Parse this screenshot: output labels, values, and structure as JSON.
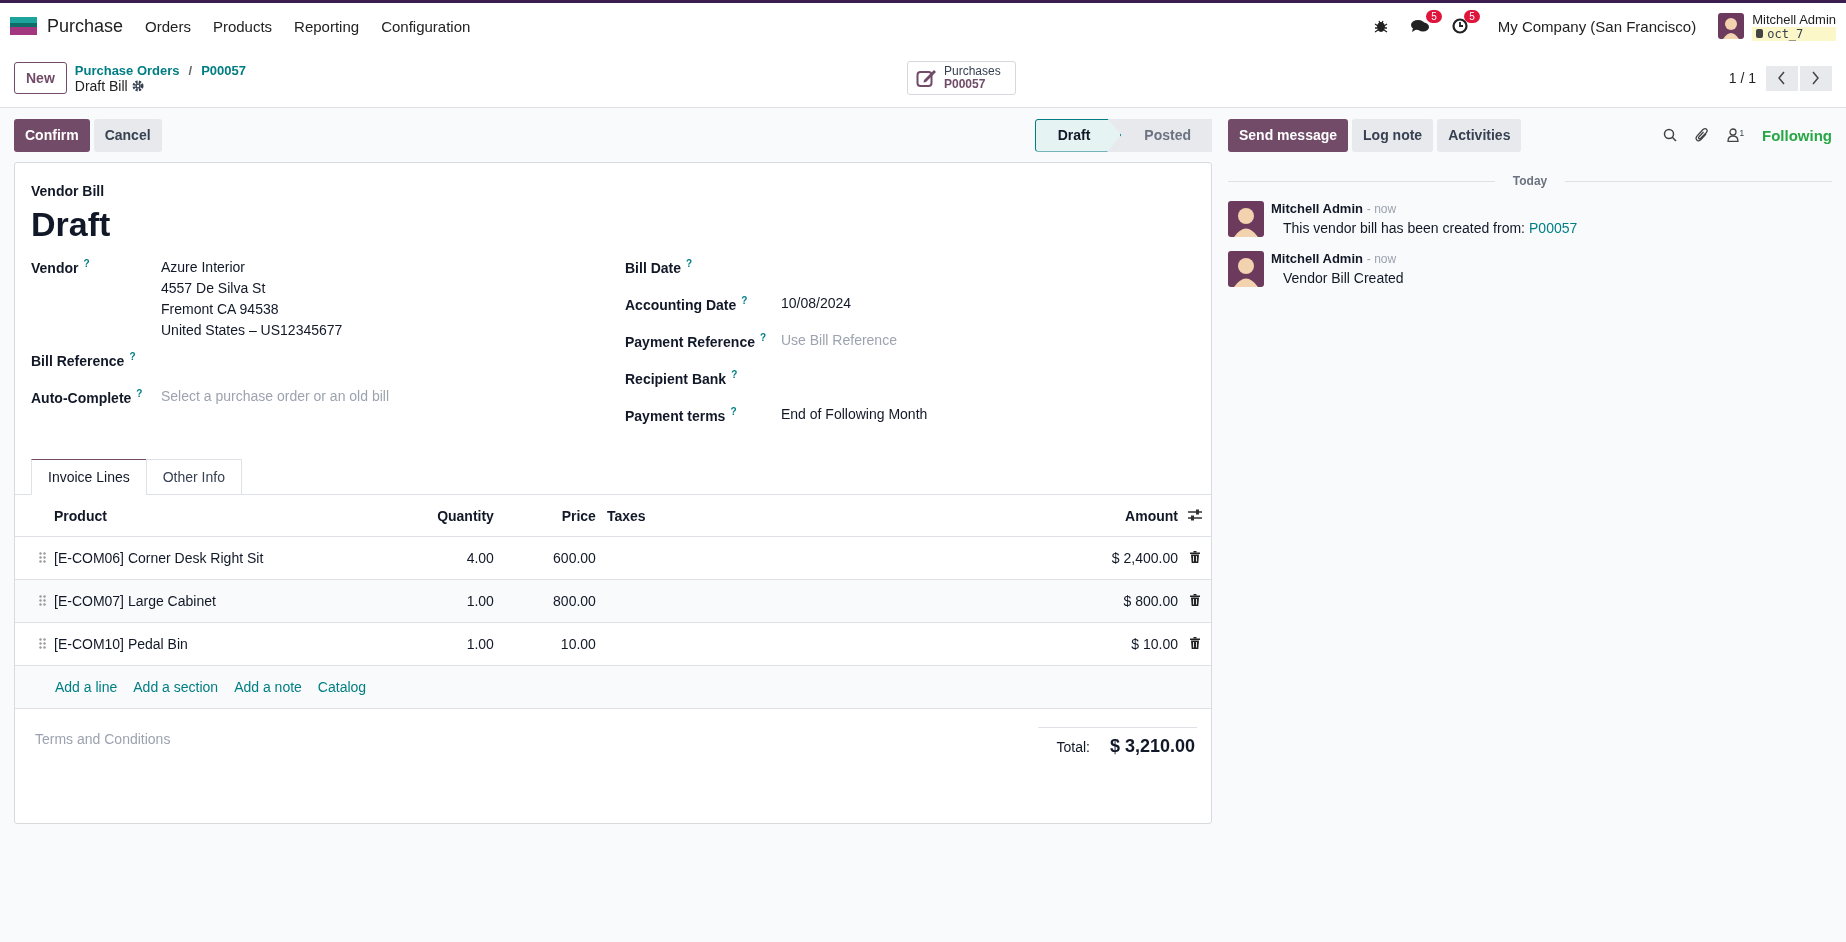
{
  "navbar": {
    "app_name": "Purchase",
    "menu": [
      "Orders",
      "Products",
      "Reporting",
      "Configuration"
    ],
    "messages_count": "5",
    "activities_count": "5",
    "company": "My Company (San Francisco)",
    "user": {
      "name": "Mitchell Admin",
      "database": "oct_7"
    }
  },
  "control_panel": {
    "new_button": "New",
    "breadcrumbs": [
      "Purchase Orders",
      "P00057"
    ],
    "breadcrumb_separator": "/",
    "record_title": "Draft Bill",
    "smart_button": {
      "label": "Purchases",
      "value": "P00057"
    },
    "pager": "1 / 1"
  },
  "actions": [
    "Confirm",
    "Cancel"
  ],
  "status_stages": [
    {
      "label": "Draft",
      "selected": true
    },
    {
      "label": "Posted",
      "selected": false
    }
  ],
  "form": {
    "type_label": "Vendor Bill",
    "title": "Draft",
    "left_fields": [
      {
        "label": "Vendor",
        "help": "?",
        "lines": [
          "Azure Interior",
          "4557 De Silva St",
          "Fremont CA 94538",
          "United States – US12345677"
        ]
      },
      {
        "label": "Bill Reference",
        "help": "?"
      },
      {
        "label": "Auto-Complete",
        "help": "?",
        "placeholder": "Select a purchase order or an old bill"
      }
    ],
    "right_fields": [
      {
        "label": "Bill Date",
        "help": "?"
      },
      {
        "label": "Accounting Date",
        "help": "?",
        "value": "10/08/2024"
      },
      {
        "label": "Payment Reference",
        "help": "?",
        "placeholder": "Use Bill Reference"
      },
      {
        "label": "Recipient Bank",
        "help": "?"
      },
      {
        "label": "Payment terms",
        "help": "?",
        "value": "End of Following Month"
      }
    ],
    "tabs": [
      {
        "label": "Invoice Lines",
        "selected": true
      },
      {
        "label": "Other Info",
        "selected": false
      }
    ],
    "table": {
      "columns": [
        "Product",
        "Quantity",
        "Price",
        "Taxes",
        "Amount"
      ],
      "rows": [
        {
          "product": "[E-COM06] Corner Desk Right Sit",
          "quantity": "4.00",
          "price": "600.00",
          "amount": "$ 2,400.00"
        },
        {
          "product": "[E-COM07] Large Cabinet",
          "quantity": "1.00",
          "price": "800.00",
          "amount": "$ 800.00"
        },
        {
          "product": "[E-COM10] Pedal Bin",
          "quantity": "1.00",
          "price": "10.00",
          "amount": "$ 10.00"
        }
      ],
      "add_links": [
        "Add a line",
        "Add a section",
        "Add a note",
        "Catalog"
      ]
    },
    "terms_placeholder": "Terms and Conditions",
    "total_label": "Total:",
    "total_value": "$ 3,210.00"
  },
  "chatter": {
    "buttons": [
      "Send message",
      "Log note",
      "Activities"
    ],
    "followers_count": "1",
    "follow_status": "Following",
    "date_separator": "Today",
    "messages": [
      {
        "author": "Mitchell Admin",
        "time": "- now",
        "text": "This vendor bill has been created from:",
        "link": "P00057"
      },
      {
        "author": "Mitchell Admin",
        "time": "- now",
        "text": "Vendor Bill Created"
      }
    ]
  }
}
